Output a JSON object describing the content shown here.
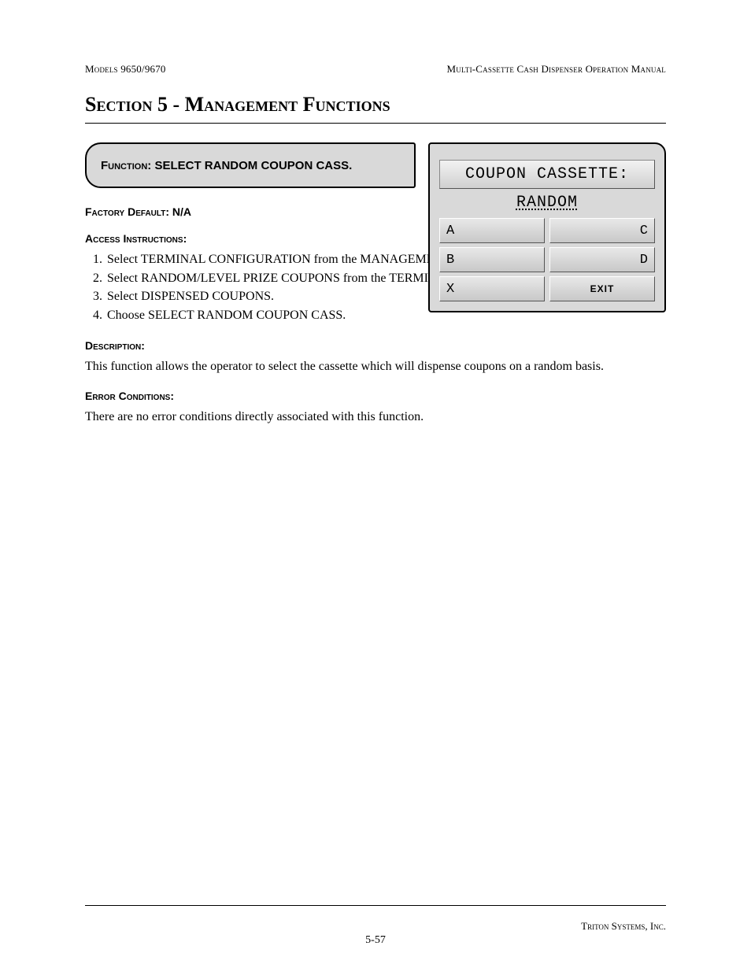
{
  "header": {
    "left": "Models 9650/9670",
    "right": "Multi-Cassette Cash Dispenser Operation Manual"
  },
  "section_title": "Section 5 - Management Functions",
  "function": {
    "label_prefix": "Function: ",
    "name": "SELECT RANDOM COUPON CASS."
  },
  "factory_default": {
    "label": "Factory Default: ",
    "value": "N/A"
  },
  "access": {
    "label": "Access Instructions:",
    "steps": [
      "Select TERMINAL CONFIGURATION from the MANAGEMENT FUNCTIONS menu.",
      "Select RANDOM/LEVEL PRIZE COUPONS from the TERMINAL CONFIGURATION menu.",
      "Select DISPENSED COUPONS.",
      "Choose SELECT RANDOM COUPON CASS."
    ]
  },
  "description": {
    "label": "Description:",
    "text": "This function allows the operator to select the cassette which will dispense coupons on a random basis."
  },
  "error": {
    "label": "Error Conditions:",
    "text": "There are no error conditions directly associated with this function."
  },
  "screen": {
    "title": "COUPON CASSETTE:",
    "subtitle": "RANDOM",
    "buttons": {
      "a": "A",
      "c": "C",
      "b": "B",
      "d": "D",
      "x": "X",
      "exit": "EXIT"
    }
  },
  "footer": {
    "company": "Triton Systems, Inc.",
    "page": "5-57"
  }
}
